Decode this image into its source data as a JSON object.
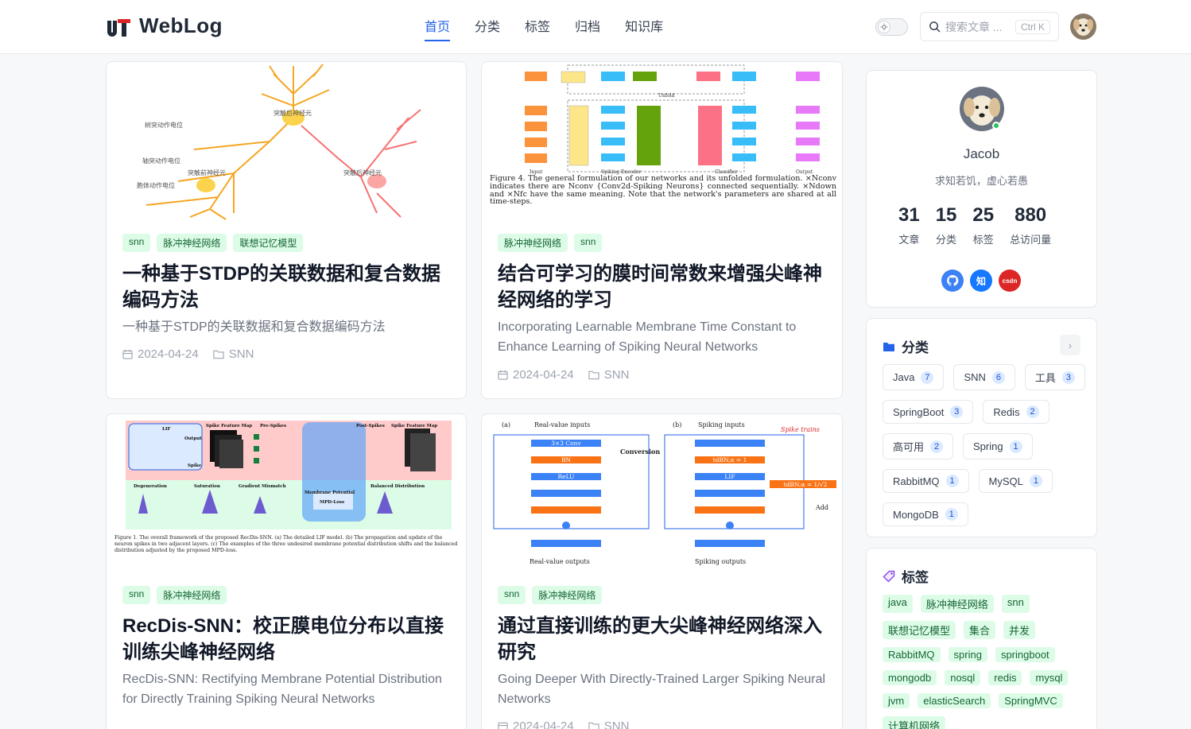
{
  "header": {
    "logo_text": "WebLog",
    "nav": [
      "首页",
      "分类",
      "标签",
      "归档",
      "知识库"
    ],
    "active_nav": 0,
    "search_placeholder": "搜索文章 ...",
    "search_shortcut": "Ctrl K"
  },
  "posts": [
    {
      "tags": [
        "snn",
        "脉冲神经网络",
        "联想记忆模型"
      ],
      "title": "一种基于STDP的关联数据和复合数据编码方法",
      "desc": "一种基于STDP的关联数据和复合数据编码方法",
      "date": "2024-04-24",
      "category": "SNN",
      "image_labels": [
        "突触后神经元",
        "树突动作电位",
        "轴突动作电位",
        "突触前神经元",
        "突触后神经元",
        "胞体动作电位"
      ]
    },
    {
      "tags": [
        "脉冲神经网络",
        "snn"
      ],
      "title": "结合可学习的膜时间常数来增强尖峰神经网络的学习",
      "desc": "Incorporating Learnable Membrane Time Constant to Enhance Learning of Spiking Neural Networks",
      "date": "2024-04-24",
      "category": "SNN",
      "image_caption": "Figure 4. The general formulation of our networks and its unfolded formulation. ×Nconv indicates there are Nconv {Conv2d-Spiking Neurons} connected sequentially. ×Ndown and ×Nfc have the same meaning. Note that the network's parameters are shared at all time-steps.",
      "image_labels": [
        "Input",
        "Spiking Encoder",
        "Classifier",
        "Output",
        "Unfold"
      ]
    },
    {
      "tags": [
        "snn",
        "脉冲神经网络"
      ],
      "title": "RecDis-SNN：校正膜电位分布以直接训练尖峰神经网络",
      "desc": "RecDis-SNN: Rectifying Membrane Potential Distribution for Directly Training Spiking Neural Networks",
      "date": "2024-04-24",
      "category": "SNN",
      "image_caption": "Figure 1. The overall framework of the proposed RecDis-SNN. (a) The detailed LIF model. (b) The propagation and update of the neuron spikes in two adjacent layers. (c) The examples of the three undesired membrane potential distribution shifts and the balanced distribution adjusted by the proposed MPD-loss.",
      "image_labels": [
        "Spike Feature Map",
        "Pre-Spikes",
        "Post-Spikes",
        "Spike Feature Map",
        "Degeneration",
        "Saturation",
        "Gradient Mismatch",
        "Balanced Distribution",
        "Membrane Potential",
        "MPD-Loss",
        "LIF",
        "Output",
        "Spike"
      ]
    },
    {
      "tags": [
        "snn",
        "脉冲神经网络"
      ],
      "title": "通过直接训练的更大尖峰神经网络深入研究",
      "desc": "Going Deeper With Directly-Trained Larger Spiking Neural Networks",
      "date": "2024-04-24",
      "category": "SNN",
      "image_labels": [
        "(a)",
        "Real-value inputs",
        "(b)",
        "Spiking inputs",
        "Spike trains",
        "3×3 Conv",
        "BN",
        "ReLU",
        "Conversion",
        "tdBN,α = 1",
        "LIF",
        "tdBN,α = 1/√2",
        "Add",
        "Real-value outputs",
        "Spiking outputs"
      ]
    }
  ],
  "profile": {
    "name": "Jacob",
    "signature": "求知若饥，虚心若愚",
    "stats": [
      {
        "num": "31",
        "label": "文章"
      },
      {
        "num": "15",
        "label": "分类"
      },
      {
        "num": "25",
        "label": "标签"
      },
      {
        "num": "880",
        "label": "总访问量"
      }
    ],
    "socials": [
      {
        "name": "github",
        "text": "",
        "color": "#3b82f6"
      },
      {
        "name": "zhihu",
        "text": "知",
        "color": "#1677ff"
      },
      {
        "name": "csdn",
        "text": "csdn",
        "color": "#dc2626"
      }
    ]
  },
  "categories": {
    "title": "分类",
    "items": [
      {
        "name": "Java",
        "count": "7"
      },
      {
        "name": "SNN",
        "count": "6"
      },
      {
        "name": "工具",
        "count": "3"
      },
      {
        "name": "SpringBoot",
        "count": "3"
      },
      {
        "name": "Redis",
        "count": "2"
      },
      {
        "name": "高可用",
        "count": "2"
      },
      {
        "name": "Spring",
        "count": "1"
      },
      {
        "name": "RabbitMQ",
        "count": "1"
      },
      {
        "name": "MySQL",
        "count": "1"
      },
      {
        "name": "MongoDB",
        "count": "1"
      }
    ]
  },
  "tags": {
    "title": "标签",
    "items": [
      "java",
      "脉冲神经网络",
      "snn",
      "联想记忆模型",
      "集合",
      "并发",
      "RabbitMQ",
      "spring",
      "springboot",
      "mongodb",
      "nosql",
      "redis",
      "mysql",
      "jvm",
      "elasticSearch",
      "SpringMVC",
      "计算机网络"
    ]
  }
}
